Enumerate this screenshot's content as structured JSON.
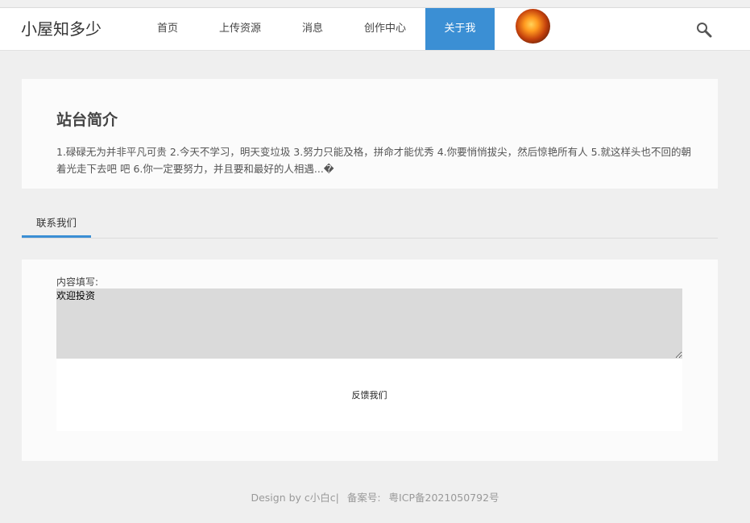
{
  "header": {
    "brand": "小屋知多少",
    "nav": [
      {
        "label": "首页"
      },
      {
        "label": "上传资源"
      },
      {
        "label": "消息"
      },
      {
        "label": "创作中心"
      },
      {
        "label": "关于我",
        "active": true
      }
    ],
    "accent_color": "#3b8fd4",
    "search_icon": "search-icon"
  },
  "intro": {
    "title": "站台简介",
    "text": "1.碌碌无为并非平凡可贵 2.今天不学习，明天变垃圾 3.努力只能及格，拼命才能优秀 4.你要悄悄拔尖，然后惊艳所有人 5.就这样头也不回的朝着光走下去吧 吧 6.你一定要努力，并且要和最好的人相遇...�"
  },
  "tabs": [
    {
      "label": "联系我们",
      "active": true
    }
  ],
  "form": {
    "label": "内容填写:",
    "value": "欢迎投资",
    "submit_label": "反馈我们"
  },
  "footer": {
    "design": "Design by c小白c|",
    "icp_label": "备案号:",
    "icp": "粤ICP备2021050792号"
  }
}
